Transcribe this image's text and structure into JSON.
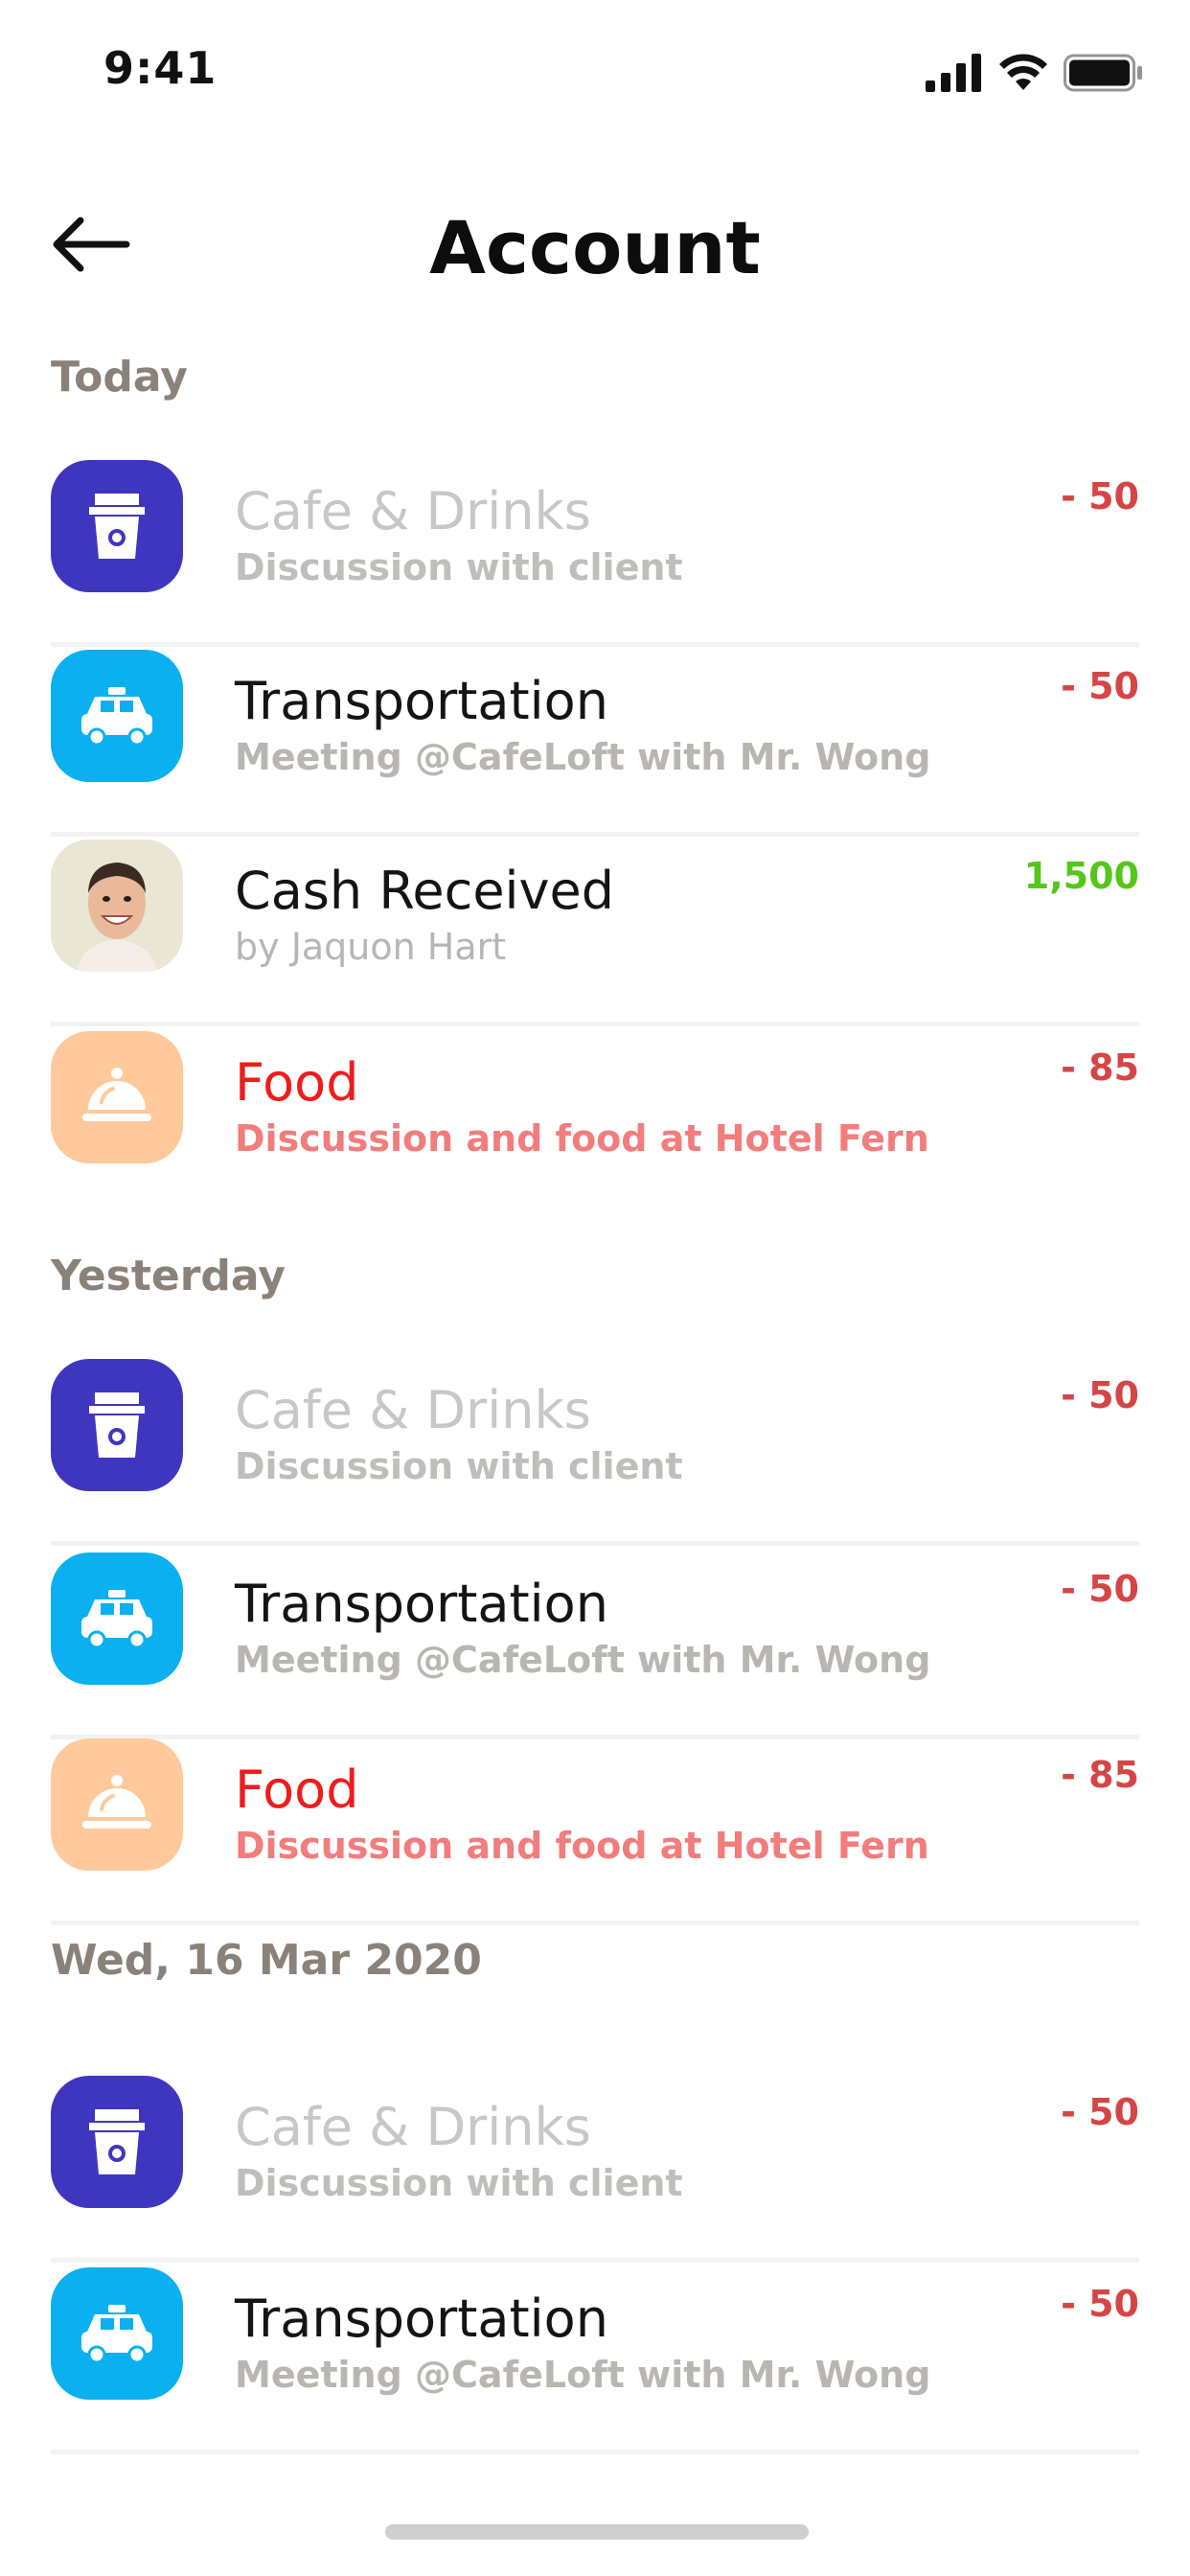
{
  "status_bar": {
    "time": "9:41"
  },
  "header": {
    "title": "Account"
  },
  "sections": [
    {
      "title": "Today",
      "items": [
        {
          "name": "Cafe & Drinks",
          "desc": "Discussion with client",
          "amount": "- 50"
        },
        {
          "name": "Transportation",
          "desc": "Meeting @CafeLoft with Mr. Wong",
          "amount": "- 50"
        },
        {
          "name": "Cash Received",
          "desc": "by Jaquon Hart",
          "amount": "1,500"
        },
        {
          "name": "Food",
          "desc": "Discussion and food at Hotel Fern",
          "amount": "- 85"
        }
      ]
    },
    {
      "title": "Yesterday",
      "items": [
        {
          "name": "Cafe & Drinks",
          "desc": "Discussion with client",
          "amount": "- 50"
        },
        {
          "name": "Transportation",
          "desc": "Meeting @CafeLoft with Mr. Wong",
          "amount": "- 50"
        },
        {
          "name": "Food",
          "desc": "Discussion and food at Hotel Fern",
          "amount": "- 85"
        }
      ]
    },
    {
      "title": "Wed, 16 Mar 2020",
      "items": [
        {
          "name": "Cafe & Drinks",
          "desc": "Discussion with client",
          "amount": "- 50"
        },
        {
          "name": "Transportation",
          "desc": "Meeting @CafeLoft with Mr. Wong",
          "amount": "- 50"
        }
      ]
    }
  ],
  "icons": {
    "cafe": "coffee-cup-icon",
    "transport": "taxi-icon",
    "cash": "avatar",
    "food": "food-cloche-icon"
  },
  "colors": {
    "cafe_bg": "#3f36c0",
    "transport_bg": "#0ab0f0",
    "food_bg": "#ffc99c",
    "expense": "#d64545",
    "income": "#56c61a",
    "food_title": "#ef1c1c"
  }
}
